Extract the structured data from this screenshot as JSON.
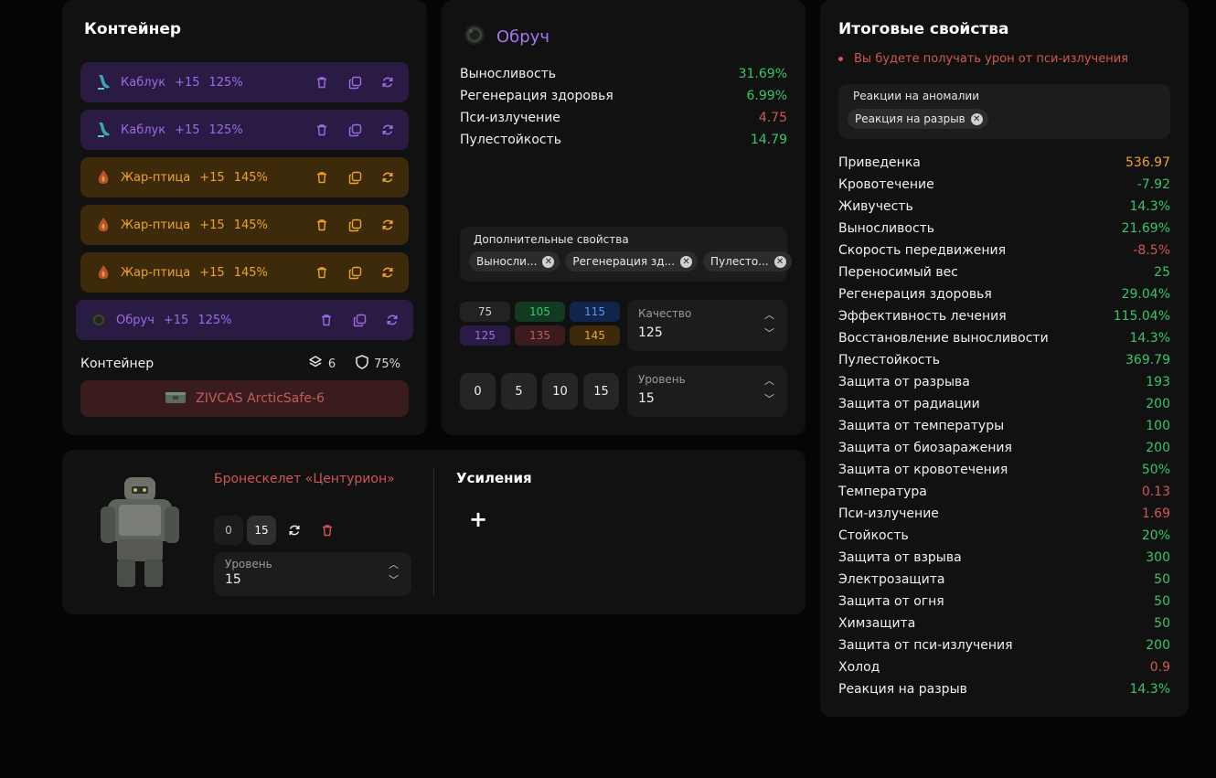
{
  "container": {
    "title": "Контейнер",
    "artifacts": [
      {
        "name": "Каблук",
        "level": "+15",
        "quality": "125%",
        "rarity": "purple",
        "icon": "heel-artifact-icon"
      },
      {
        "name": "Каблук",
        "level": "+15",
        "quality": "125%",
        "rarity": "purple",
        "icon": "heel-artifact-icon"
      },
      {
        "name": "Жар-птица",
        "level": "+15",
        "quality": "145%",
        "rarity": "orange",
        "icon": "firebird-artifact-icon"
      },
      {
        "name": "Жар-птица",
        "level": "+15",
        "quality": "145%",
        "rarity": "orange",
        "icon": "firebird-artifact-icon"
      },
      {
        "name": "Жар-птица",
        "level": "+15",
        "quality": "145%",
        "rarity": "orange",
        "icon": "firebird-artifact-icon"
      },
      {
        "name": "Обруч",
        "level": "+15",
        "quality": "125%",
        "rarity": "purple",
        "icon": "hoop-artifact-icon"
      }
    ],
    "footer_label": "Контейнер",
    "slots": "6",
    "protection": "75%",
    "container_name": "ZIVCAS ArcticSafe-6"
  },
  "detail": {
    "name": "Обруч",
    "stats": [
      {
        "label": "Выносливость",
        "value": "31.69%",
        "tone": "g"
      },
      {
        "label": "Регенерация здоровья",
        "value": "6.99%",
        "tone": "g"
      },
      {
        "label": "Пси-излучение",
        "value": "4.75",
        "tone": "r"
      },
      {
        "label": "Пулестойкость",
        "value": "14.79",
        "tone": "g"
      }
    ],
    "extra_label": "Дополнительные свойства",
    "extra_chips": [
      "Выносли...",
      "Регенерация зд...",
      "Пулесто..."
    ],
    "quality_buttons": [
      "75",
      "105",
      "115",
      "125",
      "135",
      "145"
    ],
    "quality_label": "Качество",
    "quality_value": "125",
    "level_buttons": [
      "0",
      "5",
      "10",
      "15"
    ],
    "level_label": "Уровень",
    "level_value": "15"
  },
  "armor": {
    "name": "Бронескелет «Центурион»",
    "btn_min": "0",
    "btn_max": "15",
    "level_label": "Уровень",
    "level_value": "15",
    "boosts_title": "Усиления",
    "add_label": "+"
  },
  "summary": {
    "title": "Итоговые свойства",
    "warning": "Вы будете получать урон от пси-излучения",
    "anomaly_label": "Реакции на аномалии",
    "anomaly_chip": "Реакция на разрыв",
    "stats": [
      {
        "label": "Приведенка",
        "value": "536.97",
        "tone": "o"
      },
      {
        "label": "Кровотечение",
        "value": "-7.92",
        "tone": "g"
      },
      {
        "label": "Живучесть",
        "value": "14.3%",
        "tone": "g"
      },
      {
        "label": "Выносливость",
        "value": "21.69%",
        "tone": "g"
      },
      {
        "label": "Скорость передвижения",
        "value": "-8.5%",
        "tone": "r"
      },
      {
        "label": "Переносимый вес",
        "value": "25",
        "tone": "g"
      },
      {
        "label": "Регенерация здоровья",
        "value": "29.04%",
        "tone": "g"
      },
      {
        "label": "Эффективность лечения",
        "value": "115.04%",
        "tone": "g"
      },
      {
        "label": "Восстановление выносливости",
        "value": "14.3%",
        "tone": "g"
      },
      {
        "label": "Пулестойкость",
        "value": "369.79",
        "tone": "g"
      },
      {
        "label": "Защита от разрыва",
        "value": "193",
        "tone": "g"
      },
      {
        "label": "Защита от радиации",
        "value": "200",
        "tone": "g"
      },
      {
        "label": "Защита от температуры",
        "value": "100",
        "tone": "g"
      },
      {
        "label": "Защита от биозаражения",
        "value": "200",
        "tone": "g"
      },
      {
        "label": "Защита от кровотечения",
        "value": "50%",
        "tone": "g"
      },
      {
        "label": "Температура",
        "value": "0.13",
        "tone": "r"
      },
      {
        "label": "Пси-излучение",
        "value": "1.69",
        "tone": "r"
      },
      {
        "label": "Стойкость",
        "value": "20%",
        "tone": "g"
      },
      {
        "label": "Защита от взрыва",
        "value": "300",
        "tone": "g"
      },
      {
        "label": "Электрозащита",
        "value": "50",
        "tone": "g"
      },
      {
        "label": "Защита от огня",
        "value": "50",
        "tone": "g"
      },
      {
        "label": "Химзащита",
        "value": "50",
        "tone": "g"
      },
      {
        "label": "Защита от пси-излучения",
        "value": "200",
        "tone": "g"
      },
      {
        "label": "Холод",
        "value": "0.9",
        "tone": "r"
      },
      {
        "label": "Реакция на разрыв",
        "value": "14.3%",
        "tone": "g"
      }
    ]
  },
  "colors": {
    "purple": "#9d6ae8",
    "orange": "#f0a22a",
    "green": "#35c76a",
    "red": "#d05656"
  }
}
